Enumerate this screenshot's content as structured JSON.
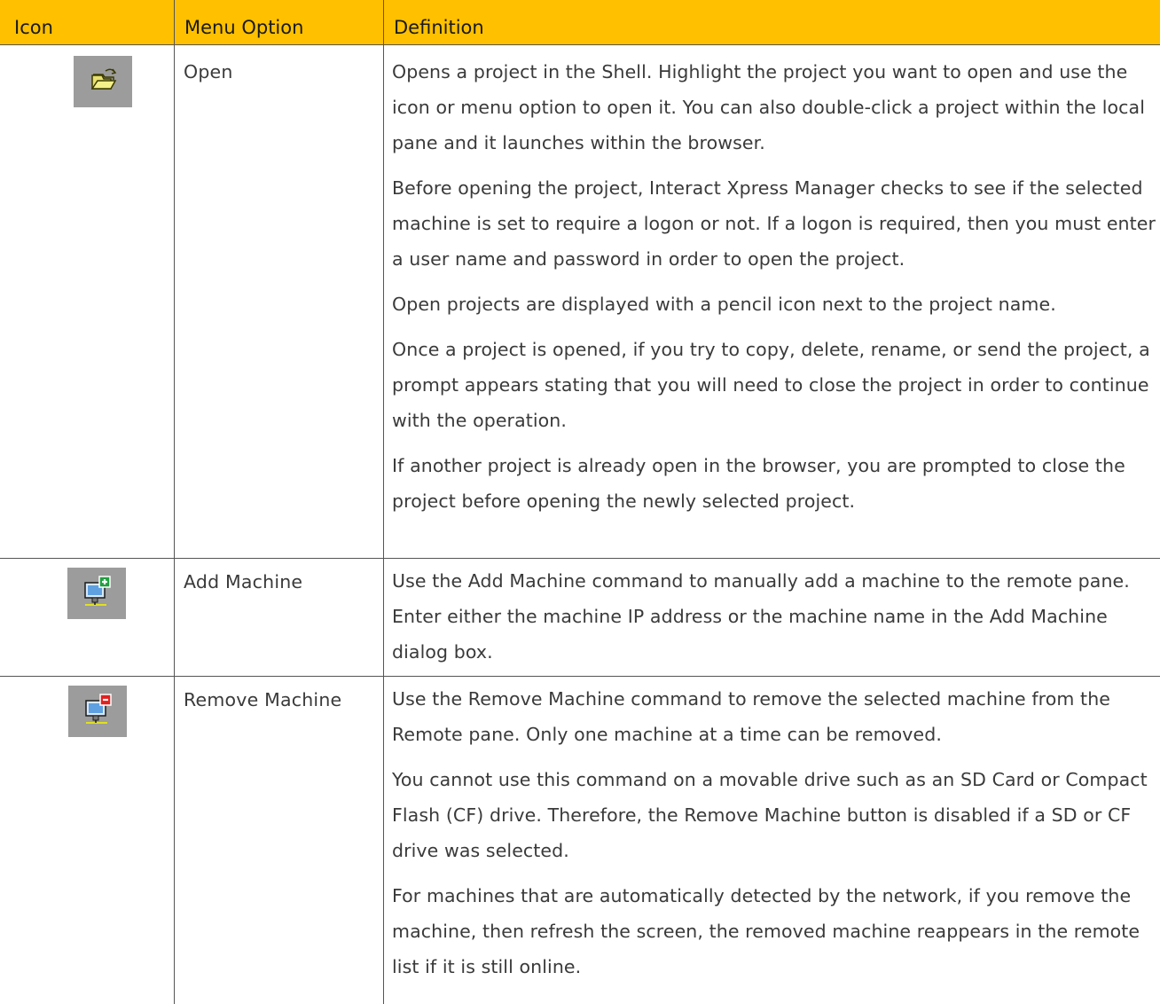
{
  "header": {
    "icon": "Icon",
    "menu_option": "Menu Option",
    "definition": "Definition"
  },
  "colors": {
    "header_background": "#ffc000",
    "icon_background": "#9c9c9c"
  },
  "rows": [
    {
      "icon": "open-folder-icon",
      "menu_option": "Open",
      "paragraphs": [
        "Opens a project in the Shell. Highlight the project you want to open and use the icon or menu option to open it. You can also double-click a project within the local pane and it launches within the browser.",
        "Before opening the project, Interact Xpress Manager checks to see if the selected machine is set to require a logon or not. If a logon is required, then you must enter a user name and password in order to open the project.",
        "Open projects are displayed with a pencil icon next to the project name.",
        "Once a project is opened, if you try to copy, delete, rename, or send the project, a prompt appears stating that you will need to close the project in order to continue with the operation.",
        "If another project is already open in the browser, you are prompted to close the project before opening the newly selected project."
      ]
    },
    {
      "icon": "add-machine-icon",
      "menu_option": "Add Machine",
      "paragraphs": [
        "Use the Add Machine command to manually add a machine to the remote pane. Enter either the machine IP address or the machine name in the Add Machine dialog box."
      ]
    },
    {
      "icon": "remove-machine-icon",
      "menu_option": "Remove Machine",
      "paragraphs": [
        "Use the Remove Machine command to remove the selected machine from the Remote pane. Only one machine at a time can be removed.",
        "You cannot use this command on a movable drive such as an SD Card or Compact Flash (CF) drive. Therefore, the Remove Machine button is disabled if a SD or CF drive was selected.",
        "For machines that are automatically detected by the network, if you remove the machine, then refresh the screen, the removed machine reappears in the remote list if it is still online."
      ]
    }
  ]
}
